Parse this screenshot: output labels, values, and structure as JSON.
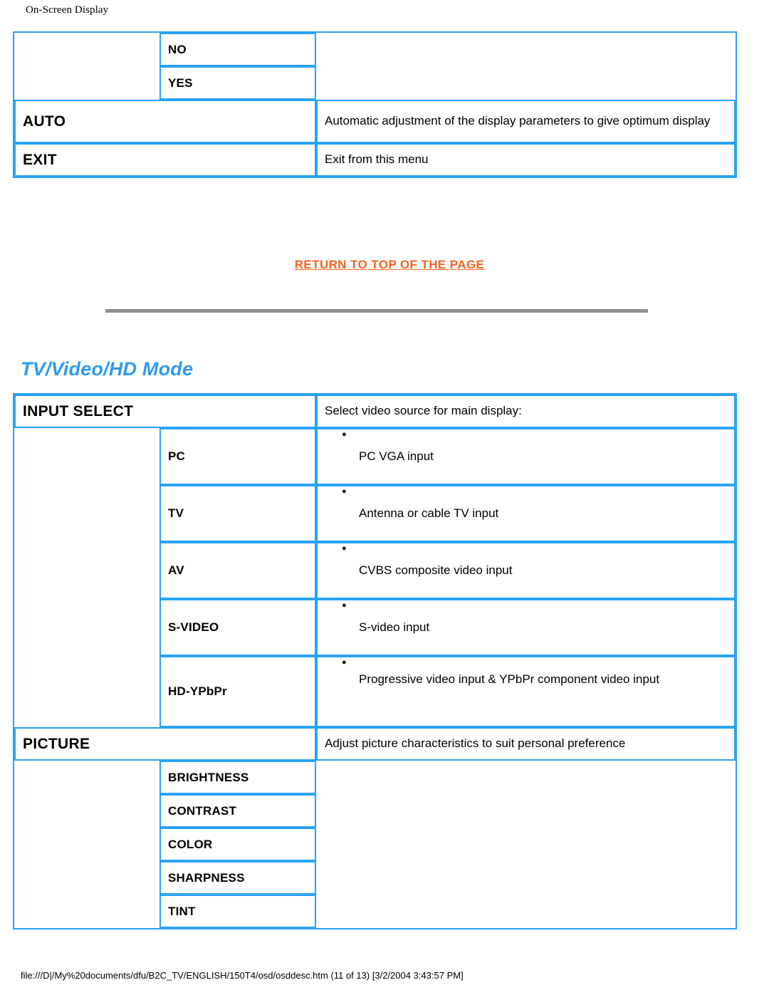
{
  "page": {
    "header": "On-Screen Display",
    "footer": "file:///D|/My%20documents/dfu/B2C_TV/ENGLISH/150T4/osd/osddesc.htm (11 of 13) [3/2/2004 3:43:57 PM]"
  },
  "colors": {
    "table_border": "#29A3F5",
    "heading_blue": "#2E9BF0",
    "link_orange": "#F4631E",
    "rule_gray": "#909090"
  },
  "top_table": {
    "rows": [
      {
        "sub": "NO",
        "desc": ""
      },
      {
        "sub": "YES",
        "desc": ""
      },
      {
        "main": "AUTO",
        "desc": "Automatic adjustment of the display parameters to give optimum display"
      },
      {
        "main": "EXIT",
        "desc": "Exit from this menu"
      }
    ]
  },
  "return_link": {
    "label": "RETURN TO TOP OF THE PAGE"
  },
  "section": {
    "heading": "TV/Video/HD Mode"
  },
  "main_table": {
    "input_select": {
      "main": "INPUT SELECT",
      "desc": "Select video source for main display:",
      "items": [
        {
          "sub": "PC",
          "desc": "PC VGA input"
        },
        {
          "sub": "TV",
          "desc": "Antenna or cable TV input"
        },
        {
          "sub": "AV",
          "desc": "CVBS composite video input"
        },
        {
          "sub": "S-VIDEO",
          "desc": "S-video input"
        },
        {
          "sub": "HD-YPbPr",
          "desc": "Progressive video input & YPbPr component video input"
        }
      ]
    },
    "picture": {
      "main": "PICTURE",
      "desc": "Adjust picture characteristics to suit personal preference",
      "items": [
        {
          "sub": "BRIGHTNESS",
          "desc": ""
        },
        {
          "sub": "CONTRAST",
          "desc": ""
        },
        {
          "sub": "COLOR",
          "desc": ""
        },
        {
          "sub": "SHARPNESS",
          "desc": ""
        },
        {
          "sub": "TINT",
          "desc": ""
        }
      ]
    }
  }
}
